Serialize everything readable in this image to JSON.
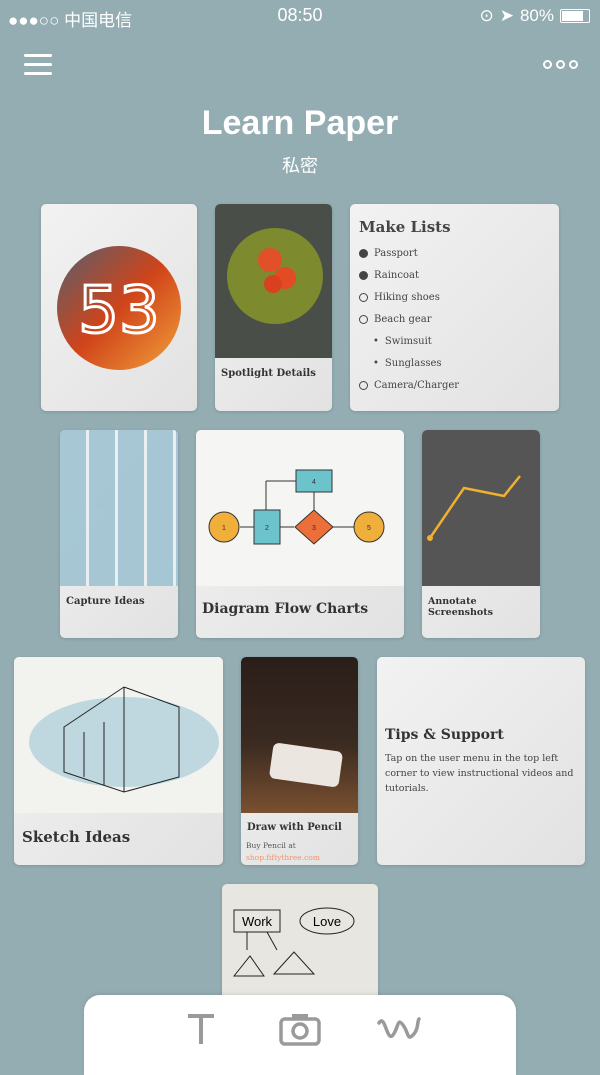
{
  "status": {
    "carrier": "●●●○○ 中国电信",
    "time": "08:50",
    "battery": "80%",
    "battery_level": 0.8
  },
  "header": {
    "title": "Learn Paper",
    "subtitle": "私密"
  },
  "cards": {
    "spotlight": "Spotlight Details",
    "lists": {
      "title": "Make Lists",
      "items": [
        {
          "label": "Passport",
          "type": "check",
          "done": true
        },
        {
          "label": "Raincoat",
          "type": "check",
          "done": true
        },
        {
          "label": "Hiking shoes",
          "type": "check",
          "done": false
        },
        {
          "label": "Beach gear",
          "type": "check",
          "done": false
        },
        {
          "label": "Swimsuit",
          "type": "bullet"
        },
        {
          "label": "Sunglasses",
          "type": "bullet"
        },
        {
          "label": "Camera/Charger",
          "type": "check",
          "done": false
        }
      ]
    },
    "capture": "Capture Ideas",
    "diagram": "Diagram Flow Charts",
    "diagram_nodes": [
      "1",
      "2",
      "3",
      "4",
      "5"
    ],
    "annotate": "Annotate Screenshots",
    "sketch": "Sketch Ideas",
    "pencil": {
      "title": "Draw with Pencil",
      "text": "Buy Pencil at",
      "link": "shop.fiftythree.com"
    },
    "tips": {
      "title": "Tips & Support",
      "text": "Tap on the user menu in the top left corner to view instructional videos and tutorials."
    },
    "partial": {
      "words": [
        "Work",
        "Love"
      ]
    }
  },
  "toolbar": {
    "icons": [
      "text-icon",
      "camera-icon",
      "draw-icon"
    ]
  },
  "colors": {
    "background": "#94adb2",
    "accent": "#e8703a",
    "link": "#f0956a"
  }
}
